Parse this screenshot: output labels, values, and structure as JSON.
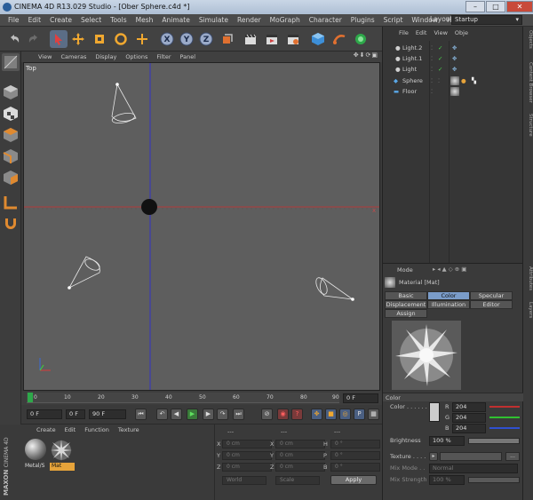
{
  "window": {
    "title": "CINEMA 4D R13.029 Studio - [Ober Sphere.c4d *]",
    "controls": [
      "–",
      "□",
      "✕"
    ]
  },
  "menubar": {
    "items": [
      "File",
      "Edit",
      "Create",
      "Select",
      "Tools",
      "Mesh",
      "Animate",
      "Simulate",
      "Render",
      "MoGraph",
      "Character",
      "Plugins",
      "Script",
      "Window",
      "Help"
    ],
    "layout_label": "Layout:",
    "layout_value": "Startup"
  },
  "toolbar": {
    "axes": [
      "X",
      "Y",
      "Z"
    ]
  },
  "viewport": {
    "menu": [
      "View",
      "Cameras",
      "Display",
      "Options",
      "Filter",
      "Panel"
    ],
    "controls": "✥⬇⟳▣",
    "label": "Top"
  },
  "timeline": {
    "ticks": [
      "0",
      "10",
      "20",
      "30",
      "40",
      "50",
      "60",
      "70",
      "80",
      "90"
    ],
    "frame_end_label": "0 F",
    "start_frame": "0 F",
    "min_frame": "0 F",
    "end_frame": "90 F",
    "max_frame": "90 F"
  },
  "material_manager": {
    "menu": [
      "Create",
      "Edit",
      "Function",
      "Texture"
    ],
    "materials": [
      {
        "name": "Metal/S",
        "selected": false
      },
      {
        "name": "Mat",
        "selected": true
      }
    ],
    "logo_line1": "MAXON",
    "logo_line2": "CINEMA 4D"
  },
  "coordinates": {
    "header1": "---",
    "header2": "---",
    "header3": "---",
    "rows": [
      {
        "a_label": "X",
        "a_value": "0 cm",
        "b_label": "X",
        "b_value": "0 cm",
        "c_label": "H",
        "c_value": "0 °"
      },
      {
        "a_label": "Y",
        "a_value": "0 cm",
        "b_label": "Y",
        "b_value": "0 cm",
        "c_label": "P",
        "c_value": "0 °"
      },
      {
        "a_label": "Z",
        "a_value": "0 cm",
        "b_label": "Z",
        "b_value": "0 cm",
        "c_label": "B",
        "c_value": "0 °"
      }
    ],
    "mode1": "World",
    "mode2": "Scale",
    "apply": "Apply"
  },
  "object_manager": {
    "menu": [
      "File",
      "Edit",
      "View",
      "Obje"
    ],
    "objects": [
      {
        "name": "Light.2",
        "type": "light"
      },
      {
        "name": "Light.1",
        "type": "light"
      },
      {
        "name": "Light",
        "type": "light"
      },
      {
        "name": "Sphere",
        "type": "sphere"
      },
      {
        "name": "Floor",
        "type": "floor"
      }
    ]
  },
  "side_tabs": [
    "Objects",
    "Content Browser",
    "Structure",
    "Attributes",
    "Layers"
  ],
  "attributes": {
    "mode_label": "Mode",
    "material_title": "Material [Mat]",
    "tabs_row1": [
      {
        "label": "Basic",
        "active": false
      },
      {
        "label": "Color",
        "active": true
      },
      {
        "label": "Specular",
        "active": false
      }
    ],
    "tabs_row2": [
      {
        "label": "Displacement",
        "active": false
      },
      {
        "label": "Illumination",
        "active": false
      },
      {
        "label": "Editor",
        "active": false
      }
    ],
    "tabs_row3": [
      {
        "label": "Assign",
        "active": false
      }
    ],
    "section": "Color",
    "color_label": "Color . . . . . .",
    "r_label": "R",
    "r_value": "204",
    "g_label": "G",
    "g_value": "204",
    "b_label": "B",
    "b_value": "204",
    "brightness_label": "Brightness",
    "brightness_value": "100 %",
    "texture_label": "Texture . . . .",
    "mixmode_label": "Mix Mode . .",
    "mixmode_value": "Normal",
    "mixstrength_label": "Mix Strength",
    "mixstrength_value": "100 %"
  },
  "colors": {
    "accent_blue": "#7a9cc9",
    "selected_orange": "#e6a33a",
    "x_axis": "#b33a3a",
    "y_axis": "#3a3ab3"
  }
}
